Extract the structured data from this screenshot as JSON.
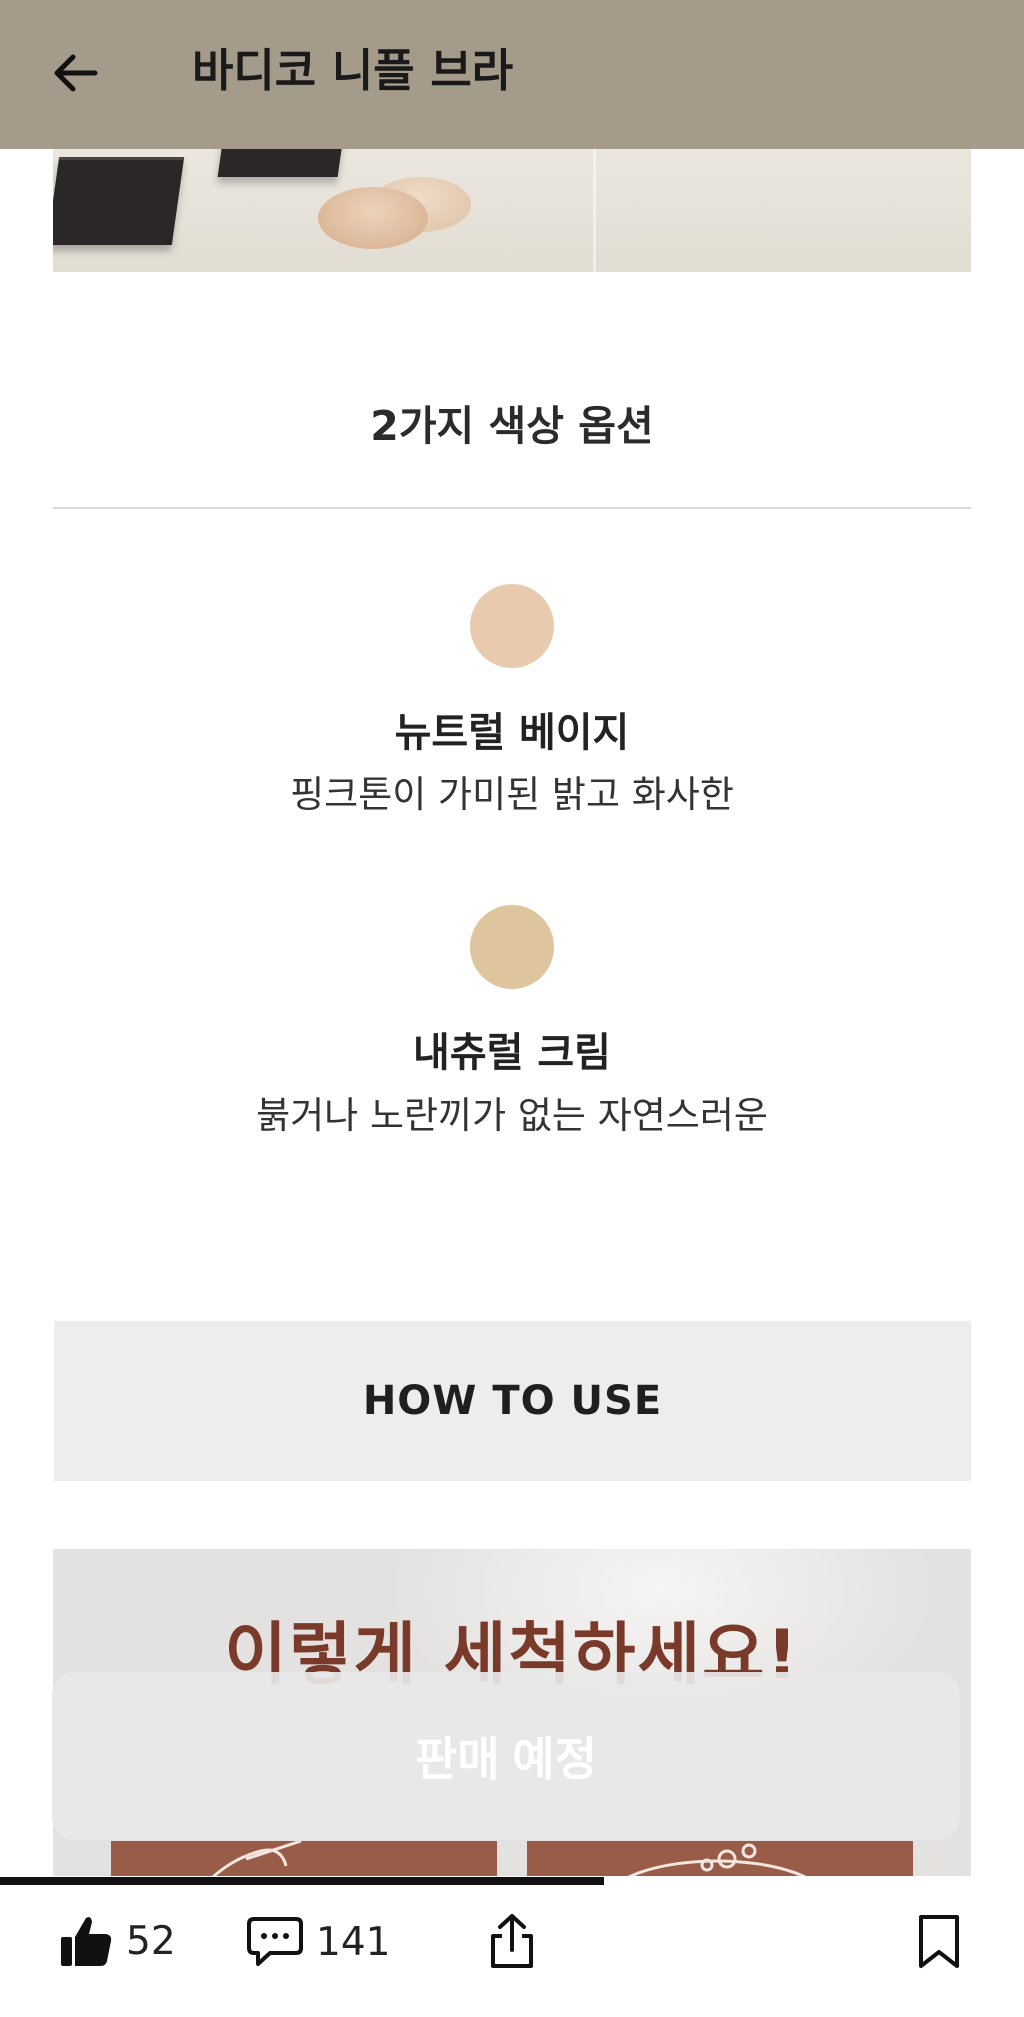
{
  "header": {
    "title": "바디코 니플 브라",
    "back_icon": "arrow-left-icon"
  },
  "colors": {
    "header_bg": "#a59b8b",
    "swatch_neutral_beige": "#e8cbae",
    "swatch_natural_cream": "#dfc59e",
    "wash_heading": "#7a3a2a",
    "wash_card": "#985c48"
  },
  "color_section": {
    "title": "2가지 색상 옵션",
    "options": [
      {
        "name": "뉴트럴 베이지",
        "description": "핑크톤이 가미된 밝고 화사한",
        "swatch_color": "#e8cbae"
      },
      {
        "name": "내츄럴 크림",
        "description": "붉거나 노란끼가 없는 자연스러운",
        "swatch_color": "#dfc59e"
      }
    ]
  },
  "how_to_use": {
    "label": "HOW TO USE"
  },
  "wash_banner": {
    "heading": "이렇게 세척하세요!"
  },
  "sale_button": {
    "label": "판매 예정"
  },
  "progress": {
    "fraction": 0.59
  },
  "bottom_bar": {
    "like_icon": "thumbs-up-icon",
    "like_count": "52",
    "comment_icon": "comment-icon",
    "comment_count": "141",
    "share_icon": "share-icon",
    "bookmark_icon": "bookmark-icon"
  }
}
